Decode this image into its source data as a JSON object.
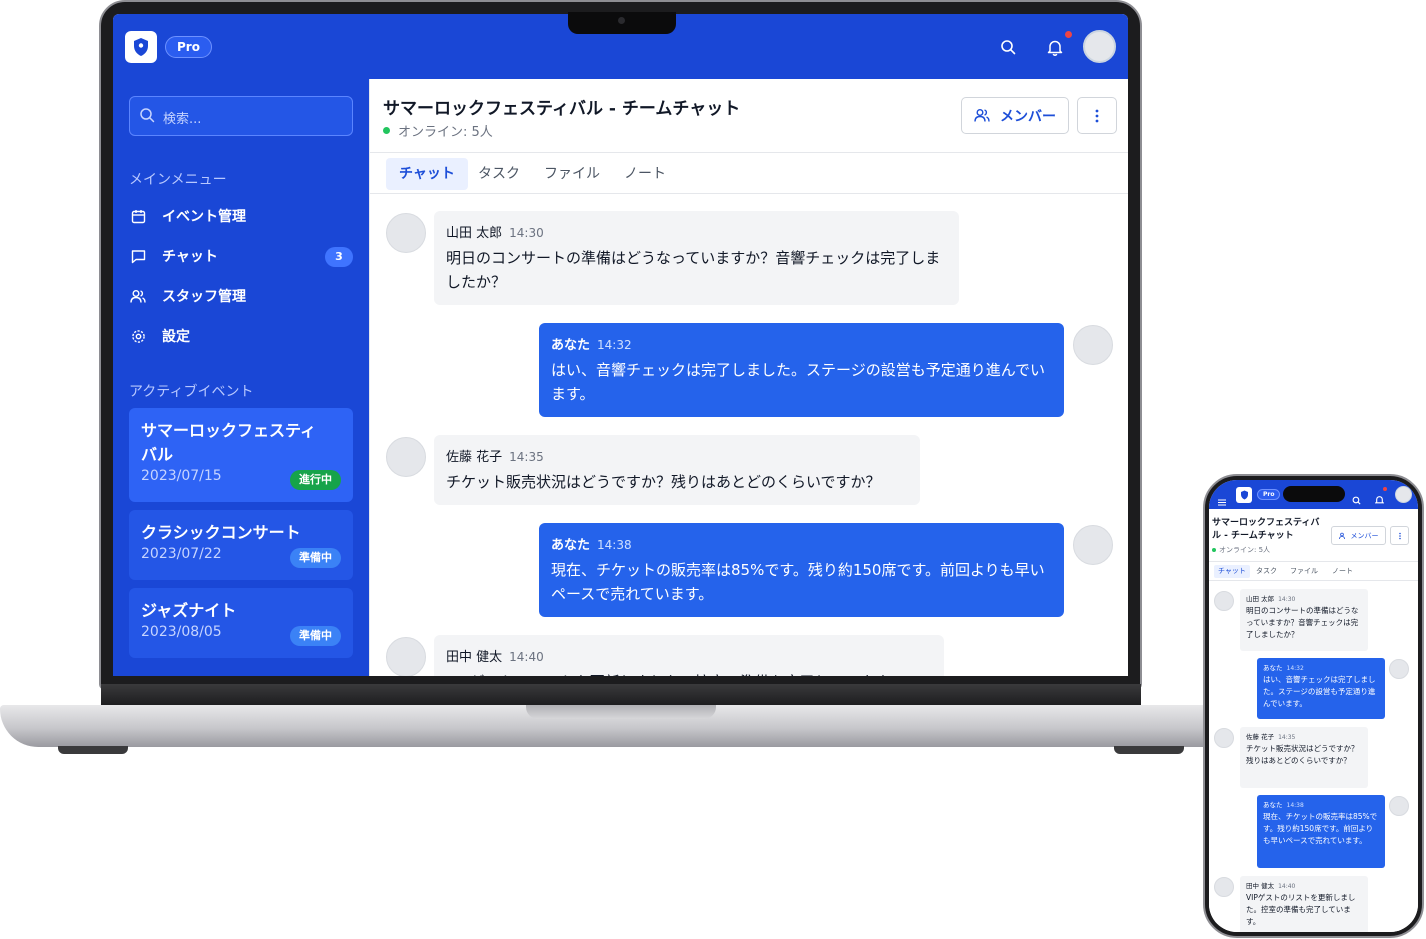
{
  "app": {
    "plan_badge": "Pro",
    "colors": {
      "primary": "#1a47d6",
      "accent": "#2563eb",
      "online": "#22c55e",
      "status_in_progress": "#16a34a",
      "status_preparing": "#3b82f6",
      "notification": "#ef4444"
    }
  },
  "header": {
    "icons": [
      "shield-logo",
      "search-icon",
      "bell-icon",
      "user-avatar"
    ]
  },
  "sidebar": {
    "search_placeholder": "検索...",
    "main_menu_label": "メインメニュー",
    "nav": [
      {
        "label": "イベント管理",
        "icon": "calendar-icon"
      },
      {
        "label": "チャット",
        "icon": "chat-icon",
        "badge": "3"
      },
      {
        "label": "スタッフ管理",
        "icon": "users-icon"
      },
      {
        "label": "設定",
        "icon": "gear-icon"
      }
    ],
    "active_events_label": "アクティブイベント",
    "events": [
      {
        "name": "サマーロックフェスティバル",
        "date": "2023/07/15",
        "status": "進行中"
      },
      {
        "name": "クラシックコンサート",
        "date": "2023/07/22",
        "status": "準備中"
      },
      {
        "name": "ジャズナイト",
        "date": "2023/08/05",
        "status": "準備中"
      }
    ]
  },
  "room": {
    "title": "サマーロックフェスティバル - チームチャット",
    "online": "オンライン: 5人",
    "members_button": "メンバー",
    "tabs": [
      "チャット",
      "タスク",
      "ファイル",
      "ノート"
    ],
    "active_tab": "チャット"
  },
  "messages": [
    {
      "author": "山田 太郎",
      "time": "14:30",
      "text": "明日のコンサートの準備はどうなっていますか？音響チェックは完了しましたか？",
      "own": false
    },
    {
      "author": "あなた",
      "time": "14:32",
      "text": "はい、音響チェックは完了しました。ステージの設営も予定通り進んでいます。",
      "own": true
    },
    {
      "author": "佐藤 花子",
      "time": "14:35",
      "text": "チケット販売状況はどうですか？残りはあとどのくらいですか？",
      "own": false
    },
    {
      "author": "あなた",
      "time": "14:38",
      "text": "現在、チケットの販売率は85%です。残り約150席です。前回よりも早いペースで売れています。",
      "own": true
    },
    {
      "author": "田中 健太",
      "time": "14:40",
      "text": "VIPゲストのリストを更新しました。控室の準備も完了しています。",
      "own": false
    }
  ]
}
